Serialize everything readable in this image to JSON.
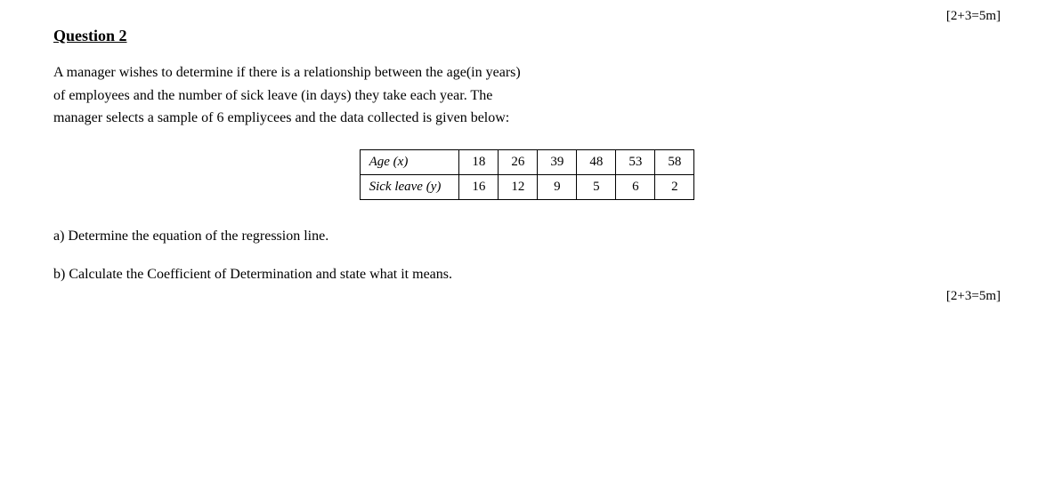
{
  "top_ref": "[2+3=5m]",
  "question": {
    "title": "Question 2",
    "body_line1": "A manager wishes to determine if there is a relationship between the age(in years)",
    "body_line2": "of employees and the number of sick leave (in days) they take each year.  The",
    "body_line3": "manager selects a sample of 6 empliycees and the data collected is given below:",
    "table": {
      "headers": [
        "Age (x)",
        "18",
        "26",
        "39",
        "48",
        "53",
        "58"
      ],
      "row2": [
        "Sick leave (y)",
        "16",
        "12",
        "9",
        "5",
        "6",
        "2"
      ]
    },
    "part_a": "a) Determine the equation of the regression line.",
    "part_b": "b) Calculate the Coefficient of Determination and state what it means.",
    "mark": "[2+3=5m]"
  }
}
